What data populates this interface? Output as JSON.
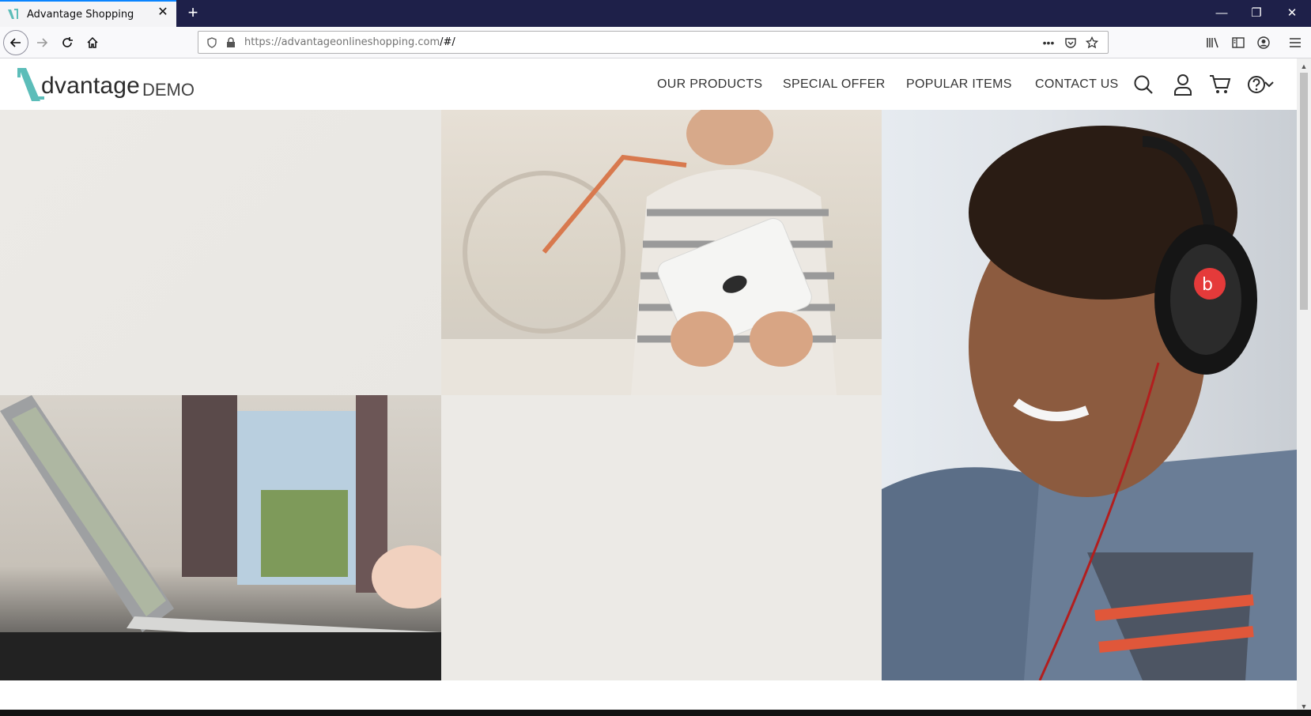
{
  "browser": {
    "tab_title": "Advantage Shopping",
    "url_host": "https://advantageonlineshopping.com",
    "url_path": "/#/"
  },
  "site": {
    "logo_word": "dvantage",
    "logo_demo": "DEMO",
    "menu": [
      {
        "label": "OUR PRODUCTS"
      },
      {
        "label": "SPECIAL OFFER"
      },
      {
        "label": "POPULAR ITEMS"
      },
      {
        "label": "CONTACT US"
      }
    ],
    "icons": [
      "search-icon",
      "user-icon",
      "cart-icon",
      "help-icon",
      "chevron-down-icon"
    ]
  },
  "colors": {
    "accent": "#5cbdb9",
    "browser_frame": "#1e2049"
  },
  "images": [
    {
      "name": "blank-banner-top-left"
    },
    {
      "name": "woman-with-tablet"
    },
    {
      "name": "man-with-headphones"
    },
    {
      "name": "laptop-on-desk"
    },
    {
      "name": "blank-banner-bottom-center"
    }
  ]
}
